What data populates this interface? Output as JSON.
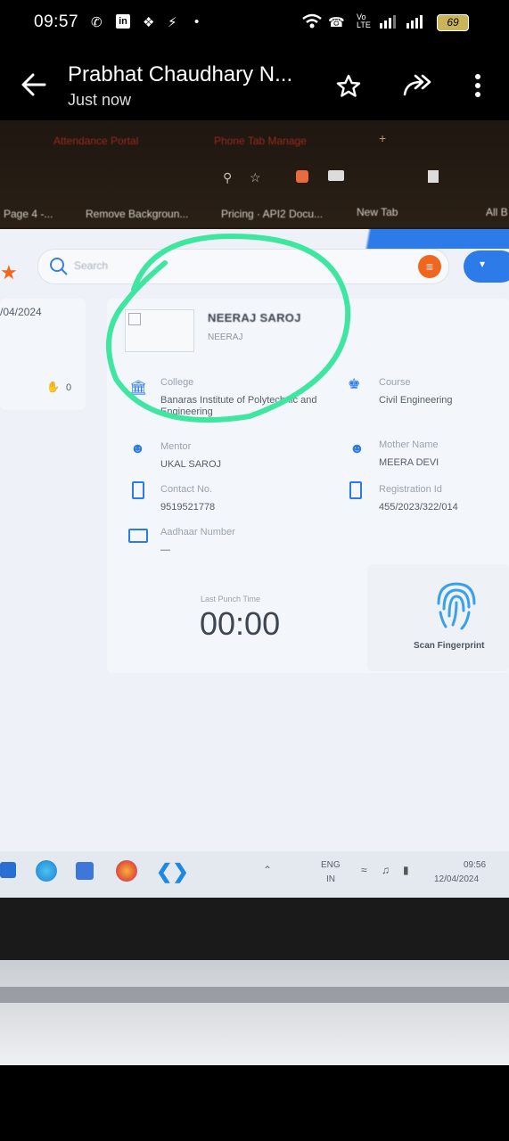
{
  "status_bar": {
    "time": "09:57",
    "battery": "69",
    "icons": [
      "whatsapp-icon",
      "linkedin-icon",
      "location-icon",
      "bolt-icon",
      "dot-icon",
      "wifi-icon",
      "wifi-call-icon",
      "volte-icon",
      "signal-icon",
      "battery-icon"
    ]
  },
  "header": {
    "title": "Prabhat Chaudhary N...",
    "subtitle": "Just now"
  },
  "photo": {
    "browser": {
      "tabs": [
        "Attendance Portal",
        "Phone Tab Manage"
      ],
      "bookmarks": [
        "Page 4 -...",
        "Remove Backgroun...",
        "Pricing · API2 Docu...",
        "New Tab",
        "All B"
      ]
    },
    "app": {
      "search_placeholder": "Search",
      "left_date": "/04/2024",
      "left_count": "0",
      "profile": {
        "name": "NEERAJ SAROJ",
        "username": "NEERAJ"
      },
      "fields": {
        "college_label": "College",
        "college_value": "Banaras Institute of Polytechnic and Engineering",
        "course_label": "Course",
        "course_value": "Civil Engineering",
        "mentor_label": "Mentor",
        "mentor_value": "UKAL SAROJ",
        "mother_label": "Mother Name",
        "mother_value": "MEERA DEVI",
        "contact_label": "Contact No.",
        "contact_value": "9519521778",
        "registration_label": "Registration Id",
        "registration_value": "455/2023/322/014",
        "aadhaar_label": "Aadhaar Number",
        "aadhaar_value": "—"
      },
      "punch_label": "Last Punch Time",
      "punch_time": "00:00",
      "scan_label": "Scan Fingerprint"
    },
    "taskbar": {
      "lang": "ENG",
      "region": "IN",
      "clock_time": "09:56",
      "clock_date": "12/04/2024"
    }
  },
  "colors": {
    "highlight": "#3ee6a0",
    "accent_blue": "#2d7be8",
    "orange": "#f0661f",
    "dark_text": "#3a4350"
  }
}
